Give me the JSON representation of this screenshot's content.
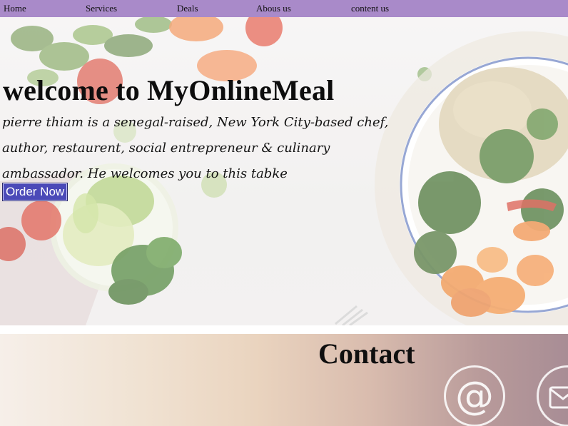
{
  "nav": {
    "items": [
      "Home",
      "Services",
      "Deals",
      "Abous us",
      "content us"
    ]
  },
  "hero": {
    "title": "welcome to MyOnlineMeal",
    "text": "pierre thiam is a senegal-raised, New York City-based chef, author, restaurent, social entrepreneur & culinary ambassador. He welcomes you to this tabke",
    "button_label": "Order Now"
  },
  "contact": {
    "title": "Contact",
    "at_symbol": "@"
  },
  "colors": {
    "nav_bg": "#a98ac9",
    "button_bg": "#4b4ab8"
  }
}
